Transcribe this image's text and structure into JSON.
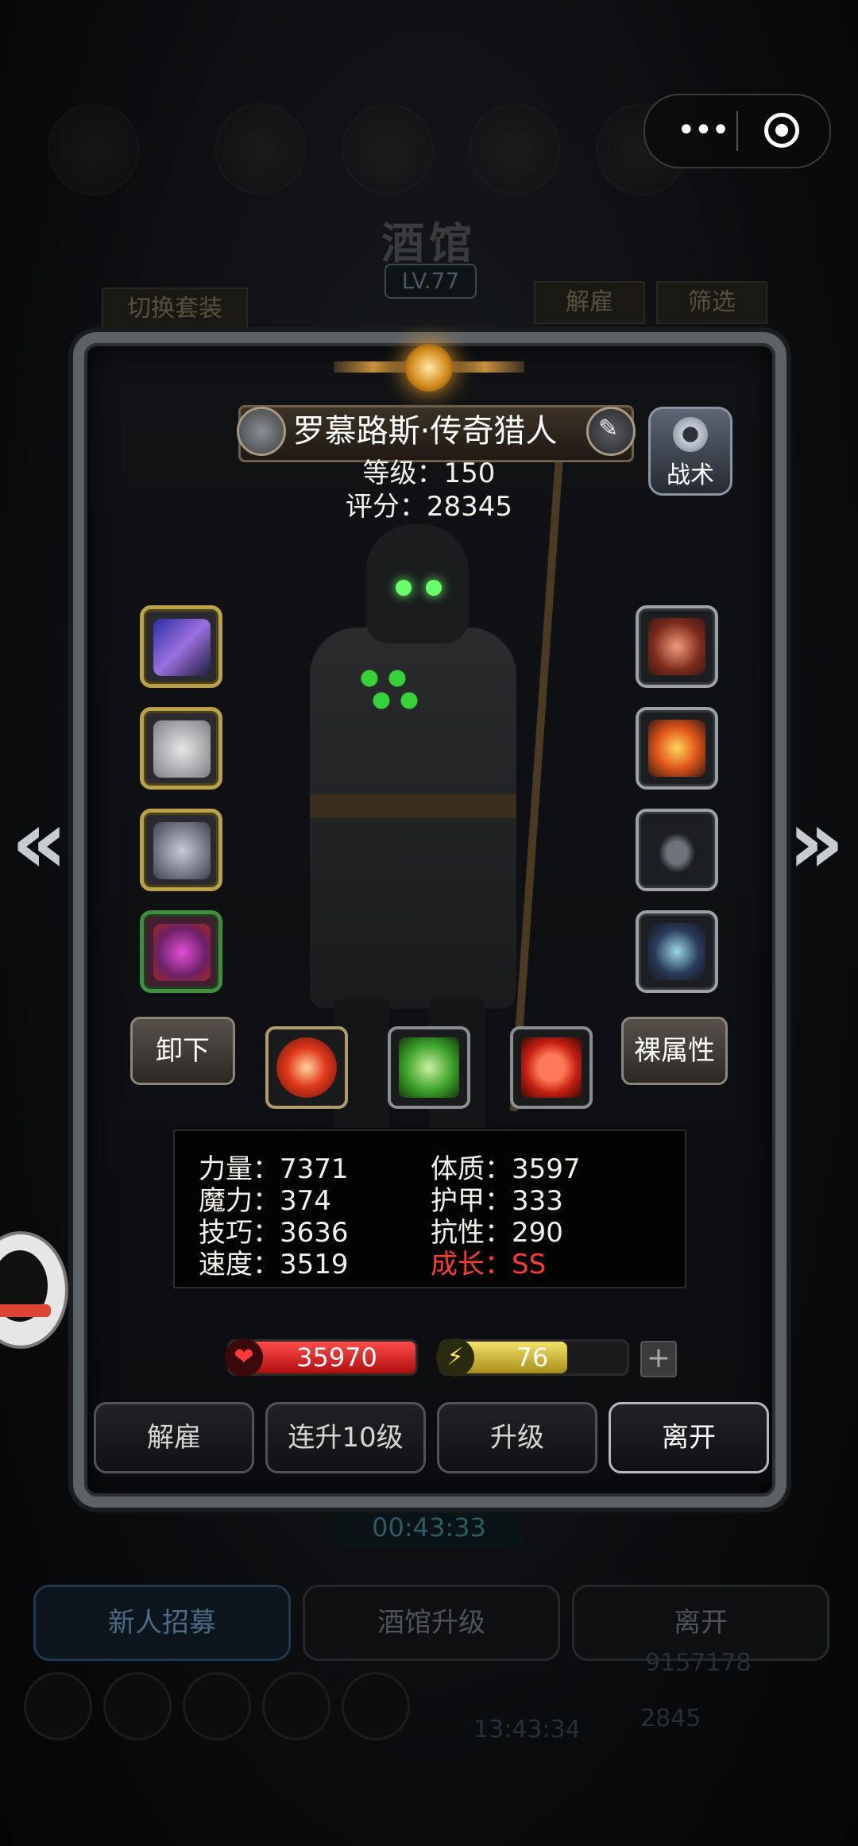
{
  "background": {
    "title": "酒馆",
    "level": "LV.77",
    "switch_outfit": "切换套装",
    "dismiss": "解雇",
    "filter": "筛选",
    "timer": "00:43:33",
    "recruit": "新人招募",
    "upgrade_tavern": "酒馆升级",
    "leave": "离开",
    "clock": "13:43:34",
    "gold": "9157178",
    "gems": "2845"
  },
  "hero": {
    "name": "罗慕路斯·传奇猎人",
    "level_line": "等级：150",
    "score_line": "评分：28345",
    "tactics_label": "战术"
  },
  "buttons": {
    "unequip": "卸下",
    "base_attr": "裸属性",
    "dismiss": "解雇",
    "level_up_10": "连升10级",
    "level_up": "升级",
    "leave": "离开"
  },
  "stats": {
    "strength": "力量：7371",
    "magic": "魔力：374",
    "skill": "技巧：3636",
    "speed": "速度：3519",
    "constitution": "体质：3597",
    "armor": "护甲：333",
    "resistance": "抗性：290",
    "growth": "成长：SS"
  },
  "bars": {
    "hp": "35970",
    "energy": "76",
    "energy_fill": 0.68
  },
  "colors": {
    "growth": "#ff3b2f",
    "hp_red": "#d42020",
    "energy_yellow": "#e6cf40"
  },
  "icons": {
    "left_arrow": "double-chevron-left",
    "right_arrow": "double-chevron-right",
    "more": "more-dots",
    "close": "target-circle"
  }
}
